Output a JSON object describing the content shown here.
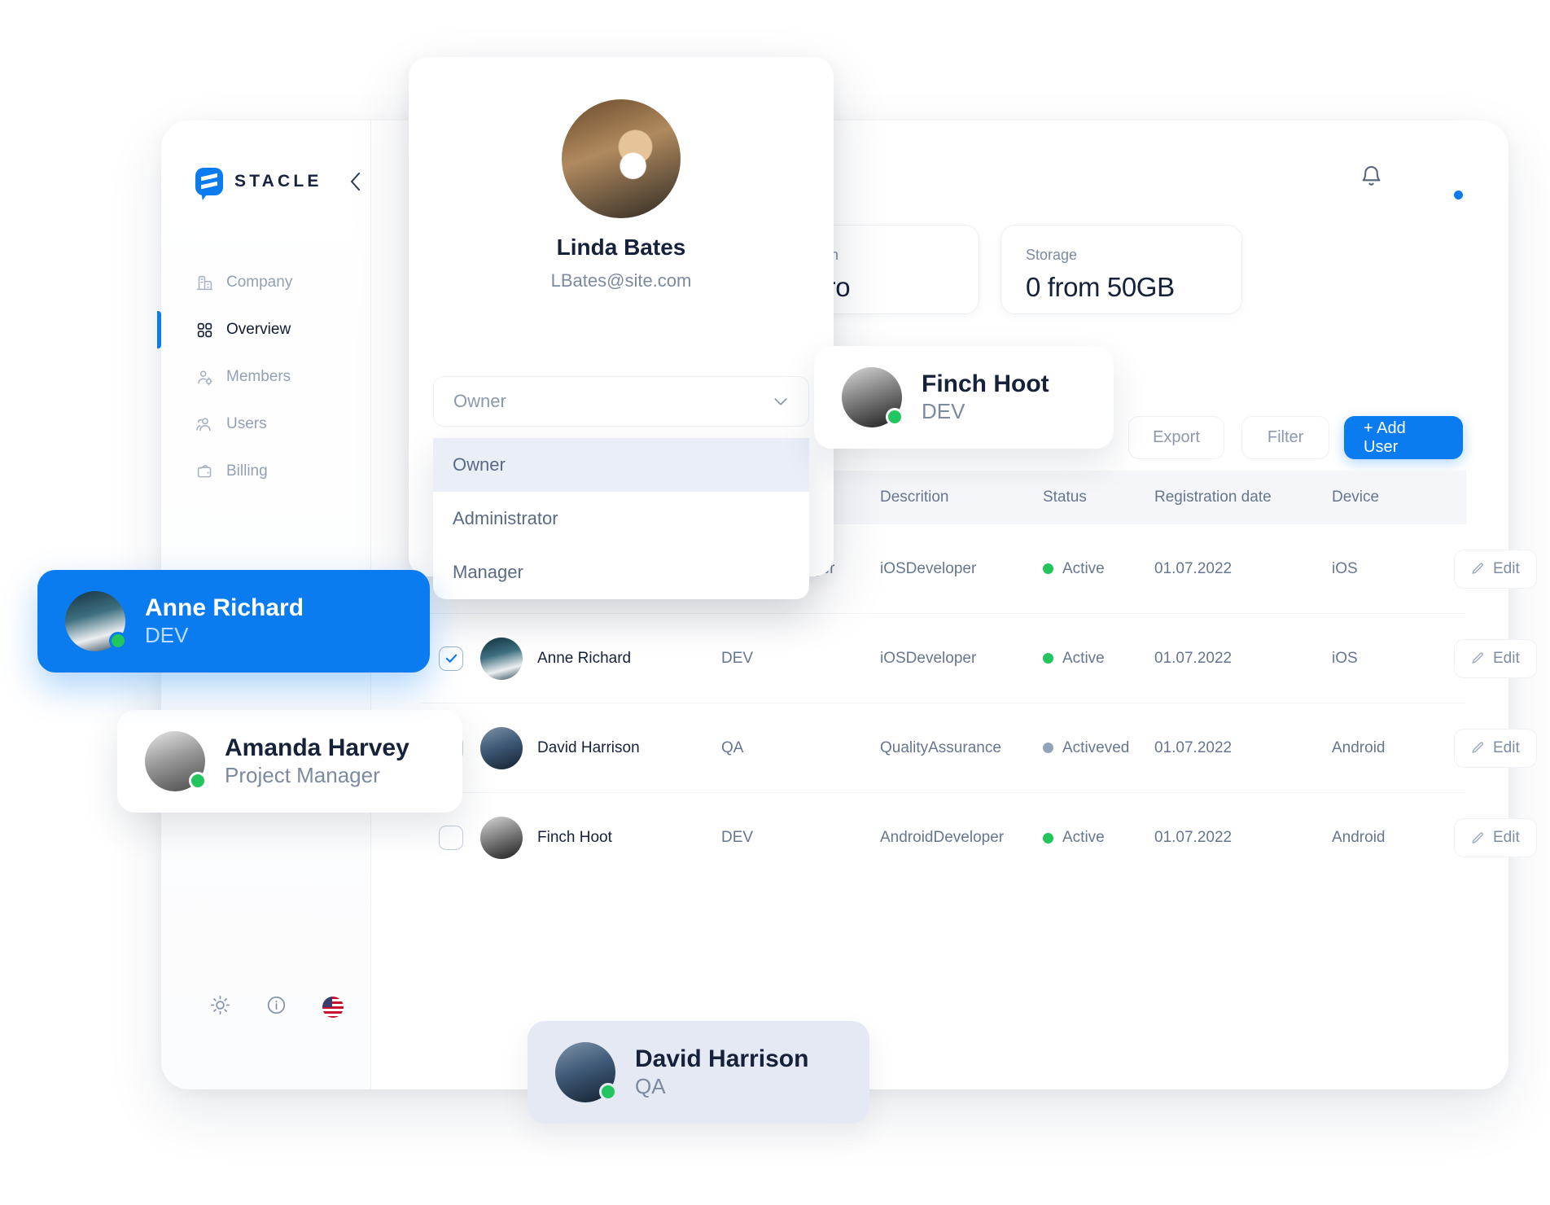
{
  "brand": {
    "name": "STACLE"
  },
  "sidebar": {
    "items": [
      {
        "label": "Company",
        "icon": "building-icon",
        "active": false
      },
      {
        "label": "Overview",
        "icon": "grid-icon",
        "active": true
      },
      {
        "label": "Members",
        "icon": "user-gear-icon",
        "active": false
      },
      {
        "label": "Users",
        "icon": "users-icon",
        "active": false
      },
      {
        "label": "Billing",
        "icon": "wallet-icon",
        "active": false
      }
    ],
    "footer_icons": [
      "sun-icon",
      "info-icon",
      "us-flag-icon"
    ]
  },
  "topbar": {
    "bell": "bell-icon",
    "avatar": "user-avatar",
    "status": "online"
  },
  "stats": [
    {
      "label": "Plan",
      "value": "Pro"
    },
    {
      "label": "Storage",
      "value": "0 from 50GB"
    }
  ],
  "toolbar": {
    "export_label": "Export",
    "filter_label": "Filter",
    "add_user_label": "+ Add User"
  },
  "table": {
    "columns": [
      "Descrition",
      "Status",
      "Registration date",
      "Device"
    ],
    "rows": [
      {
        "checked": true,
        "name": "Amanda Harvey",
        "role": "Project Manager",
        "desc": "iOSDeveloper",
        "status": "Active",
        "status_color": "#22c55e",
        "date": "01.07.2022",
        "device": "iOS",
        "edit": "Edit"
      },
      {
        "checked": true,
        "name": "Anne Richard",
        "role": "DEV",
        "desc": "iOSDeveloper",
        "status": "Active",
        "status_color": "#22c55e",
        "date": "01.07.2022",
        "device": "iOS",
        "edit": "Edit"
      },
      {
        "checked": false,
        "name": "David Harrison",
        "role": "QA",
        "desc": "QualityAssurance",
        "status": "Activeved",
        "status_color": "#93a3ba",
        "date": "01.07.2022",
        "device": "Android",
        "edit": "Edit"
      },
      {
        "checked": false,
        "name": "Finch Hoot",
        "role": "DEV",
        "desc": "AndroidDeveloper",
        "status": "Active",
        "status_color": "#22c55e",
        "date": "01.07.2022",
        "device": "Android",
        "edit": "Edit"
      }
    ]
  },
  "role_modal": {
    "name": "Linda Bates",
    "email": "LBates@site.com",
    "select_value": "Owner",
    "options": [
      {
        "label": "Owner",
        "selected": true
      },
      {
        "label": "Administrator",
        "selected": false
      },
      {
        "label": "Manager",
        "selected": false
      }
    ]
  },
  "people_cards": [
    {
      "id": "anne",
      "name": "Anne Richard",
      "role": "DEV",
      "status": "online"
    },
    {
      "id": "amanda",
      "name": "Amanda Harvey",
      "role": "Project Manager",
      "status": "online"
    },
    {
      "id": "finch",
      "name": "Finch Hoot",
      "role": "DEV",
      "status": "online"
    },
    {
      "id": "david",
      "name": "David Harrison",
      "role": "QA",
      "status": "online"
    }
  ],
  "colors": {
    "accent": "#0a7cf0",
    "online": "#22c55e",
    "muted": "#93a3ba"
  }
}
